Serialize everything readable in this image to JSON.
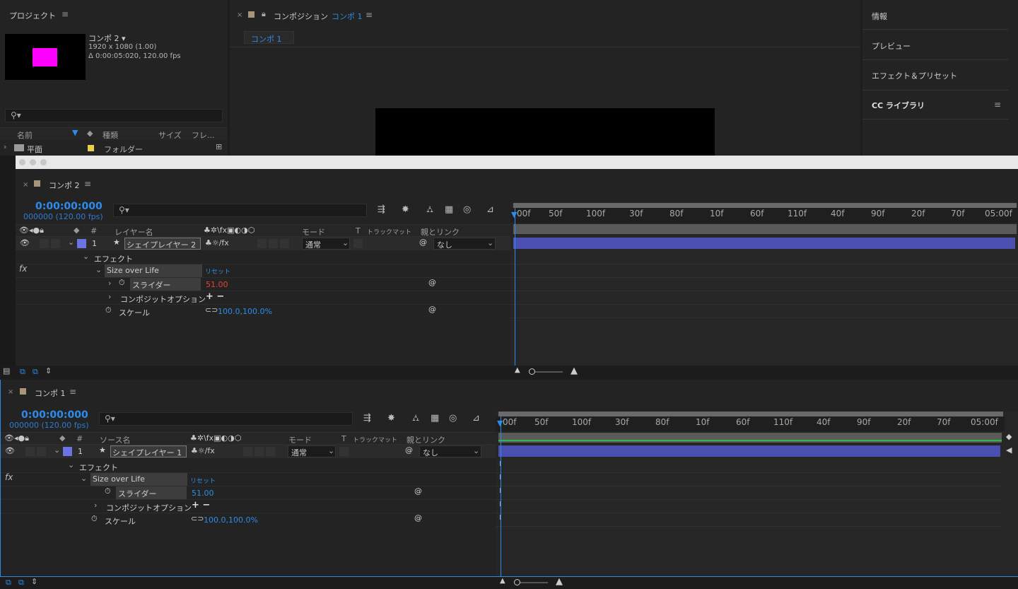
{
  "project": {
    "title": "プロジェクト",
    "comp_name": "コンポ 2 ▾",
    "comp_res": "1920 x 1080 (1.00)",
    "comp_dur": "Δ 0:00:05:020, 120.00 fps",
    "columns": [
      "名前",
      "種類",
      "サイズ",
      "フレ..."
    ],
    "row_name": "平面",
    "row_type": "フォルダー",
    "thumb_color": "#ff00ff"
  },
  "composition": {
    "title": "コンポジション",
    "comp_link": "コンポ 1",
    "tab": "コンポ 1"
  },
  "right_panel": {
    "items": [
      "情報",
      "プレビュー",
      "エフェクト＆プリセット",
      "CC ライブラリ"
    ]
  },
  "timeline_top": {
    "tab": "コンポ 2",
    "timecode": "0:00:00:000",
    "frames": "000000 (120.00 fps)",
    "headers": {
      "num": "#",
      "name": "レイヤー名",
      "mode": "モード",
      "t": "T",
      "trkmat": "トラックマット",
      "parent": "親とリンク"
    },
    "layer": {
      "num": "1",
      "name": "シェイプレイヤー 2",
      "mode": "通常",
      "parent": "なし"
    },
    "effects_label": "エフェクト",
    "effect_name": "Size over Life",
    "reset": "リセット",
    "slider_label": "スライダー",
    "slider_value": "51.00",
    "composite_label": "コンポジットオプション",
    "plusminus": "+ −",
    "scale_label": "スケール",
    "scale_value": "100.0,100.0%",
    "ruler": [
      "00f",
      "50f",
      "100f",
      "30f",
      "80f",
      "10f",
      "60f",
      "110f",
      "40f",
      "90f",
      "20f",
      "70f",
      "05:00f"
    ]
  },
  "timeline_bottom": {
    "tab": "コンポ 1",
    "timecode": "0:00:00:000",
    "frames": "000000 (120.00 fps)",
    "headers": {
      "num": "#",
      "name": "ソース名",
      "mode": "モード",
      "t": "T",
      "trkmat": "トラックマット",
      "parent": "親とリンク"
    },
    "layer": {
      "num": "1",
      "name": "シェイプレイヤー 1",
      "mode": "通常",
      "parent": "なし"
    },
    "effects_label": "エフェクト",
    "effect_name": "Size over Life",
    "reset": "リセット",
    "slider_label": "スライダー",
    "slider_value": "51.00",
    "composite_label": "コンポジットオプション",
    "plusminus": "+ −",
    "scale_label": "スケール",
    "scale_value": "100.0,100.0%",
    "ruler": [
      "00f",
      "50f",
      "100f",
      "30f",
      "80f",
      "10f",
      "60f",
      "110f",
      "40f",
      "90f",
      "20f",
      "70f",
      "05:00f"
    ]
  },
  "colors": {
    "accent": "#2d8ceb",
    "layer_label": "#6b74e0",
    "bar": "#4a4fb0",
    "green": "#2fb84a"
  }
}
